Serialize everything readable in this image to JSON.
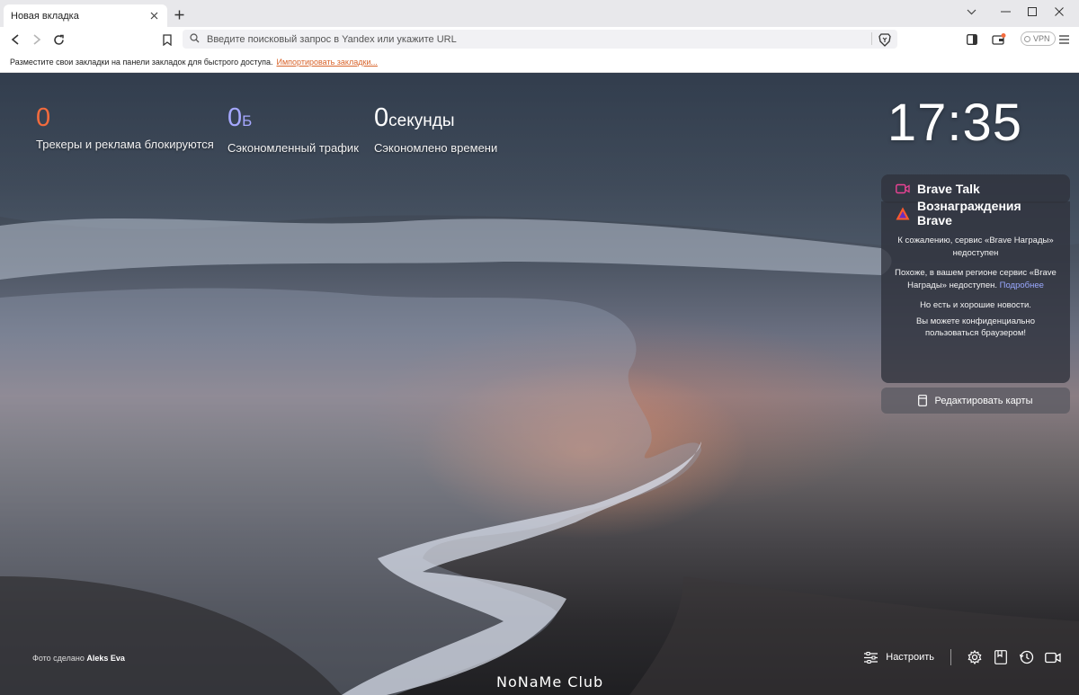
{
  "tab": {
    "title": "Новая вкладка"
  },
  "toolbar": {
    "url_placeholder": "Введите поисковый запрос в Yandex или укажите URL",
    "vpn_label": "VPN"
  },
  "bookmarks_bar": {
    "message": "Разместите свои закладки на панели закладок для быстрого доступа.",
    "import_link": "Импортировать закладки..."
  },
  "stats": [
    {
      "value": "0",
      "unit": "",
      "label": "Трекеры и реклама блокируются",
      "color": "#f36b3d"
    },
    {
      "value": "0",
      "unit": "Б",
      "label": "Сэкономленный трафик",
      "color": "#a5a8ff"
    },
    {
      "value": "0",
      "unit": "секунды",
      "label": "Сэкономлено времени",
      "color": "#ffffff"
    }
  ],
  "clock": "17:35",
  "cards": {
    "talk_title": "Brave Talk",
    "rewards_title": "Вознаграждения Brave",
    "rewards_msg_1": "К сожалению, сервис «Brave Награды» недоступен",
    "rewards_msg_2": "Похоже, в вашем регионе сервис «Brave Награды» недоступен.",
    "rewards_more": "Подробнее",
    "rewards_msg_3": "Но есть и хорошие новости.",
    "rewards_msg_4": "Вы можете конфиденциально пользоваться браузером!",
    "edit_cards": "Редактировать карты"
  },
  "photo_credit": {
    "prefix": "Фото сделано",
    "author": "Aleks Eva"
  },
  "bottom_bar": {
    "customize": "Настроить"
  },
  "watermark": "NoNaMe Club",
  "colors": {
    "accent_orange": "#f36b3d",
    "accent_purple": "#a5a8ff",
    "link_orange": "#d8632a"
  }
}
